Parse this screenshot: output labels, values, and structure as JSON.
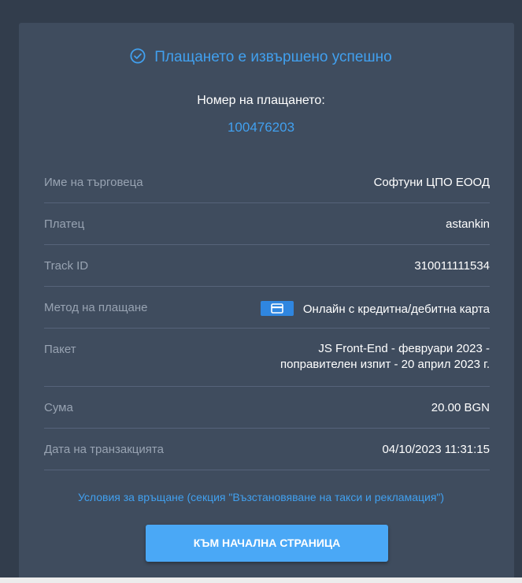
{
  "status": {
    "title": "Плащането е извършено успешно",
    "icon": "check-circle-icon"
  },
  "payment_number": {
    "label": "Номер на плащането:",
    "value": "100476203"
  },
  "details": [
    {
      "label": "Име на търговеца",
      "value": "Софтуни ЦПО ЕООД"
    },
    {
      "label": "Платец",
      "value": "astankin"
    },
    {
      "label": "Track ID",
      "value": "310011111534"
    },
    {
      "label": "Метод на плащане",
      "value": "Онлайн с кредитна/дебитна карта",
      "icon": "credit-card-icon"
    },
    {
      "label": "Пакет",
      "value_line1": "JS Front-End - февруари 2023 -",
      "value_line2": "поправителен изпит - 20 април 2023 г."
    },
    {
      "label": "Сума",
      "value": "20.00 BGN"
    },
    {
      "label": "Дата на транзакцията",
      "value": "04/10/2023 11:31:15"
    }
  ],
  "refund_link": "Условия за връщане (секция \"Възстановяване на такси и рекламация\")",
  "home_button": "КЪМ НАЧАЛНА СТРАНИЦА",
  "colors": {
    "accent": "#41a0ef",
    "button": "#4aa8f6",
    "card": "#3f4c5e",
    "background": "#323d4c"
  }
}
